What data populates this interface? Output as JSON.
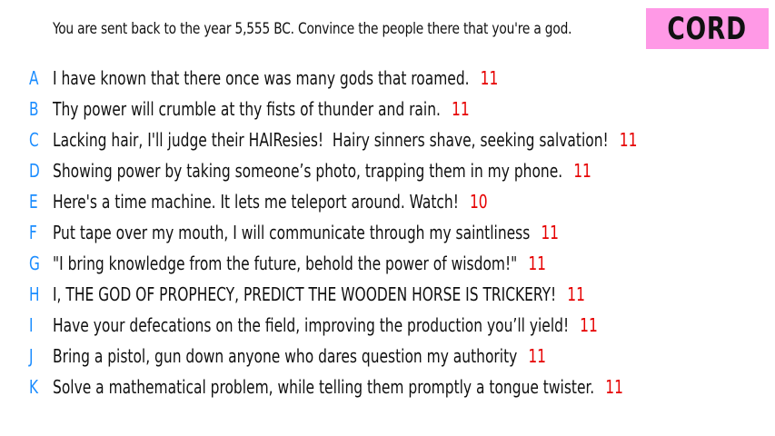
{
  "prompt": "You are sent back to the year 5,555 BC. Convince the people there that you're a god.",
  "badge": {
    "label": "CORD",
    "color": "#ff99e6"
  },
  "colors": {
    "letter": "#1a8cff",
    "score": "#e60000",
    "text": "#111111"
  },
  "answers": [
    {
      "letter": "A",
      "text": "I have known that there once was many gods that roamed.",
      "score": "11"
    },
    {
      "letter": "B",
      "text": "Thy power will crumble at thy fists of thunder and rain.",
      "score": "11"
    },
    {
      "letter": "C",
      "text": "Lacking hair, I'll judge their HAIResies!  Hairy sinners shave, seeking salvation!",
      "score": "11"
    },
    {
      "letter": "D",
      "text": "Showing power by taking someone’s photo, trapping them in my phone.",
      "score": "11"
    },
    {
      "letter": "E",
      "text": "Here's a time machine. It lets me teleport around. Watch!",
      "score": "10"
    },
    {
      "letter": "F",
      "text": "Put tape over my mouth, I will communicate through my saintliness",
      "score": "11"
    },
    {
      "letter": "G",
      "text": "\"I bring knowledge from the future, behold the power of wisdom!\"",
      "score": "11"
    },
    {
      "letter": "H",
      "text": "I, THE GOD OF PROPHECY, PREDICT THE WOODEN HORSE IS TRICKERY!",
      "score": "11"
    },
    {
      "letter": "I",
      "text": "Have your defecations on the field, improving the production you’ll yield!",
      "score": "11"
    },
    {
      "letter": "J",
      "text": "Bring a pistol, gun down anyone who dares question my authority",
      "score": "11"
    },
    {
      "letter": "K",
      "text": "Solve a mathematical problem, while telling them promptly a tongue twister.",
      "score": "11"
    }
  ]
}
